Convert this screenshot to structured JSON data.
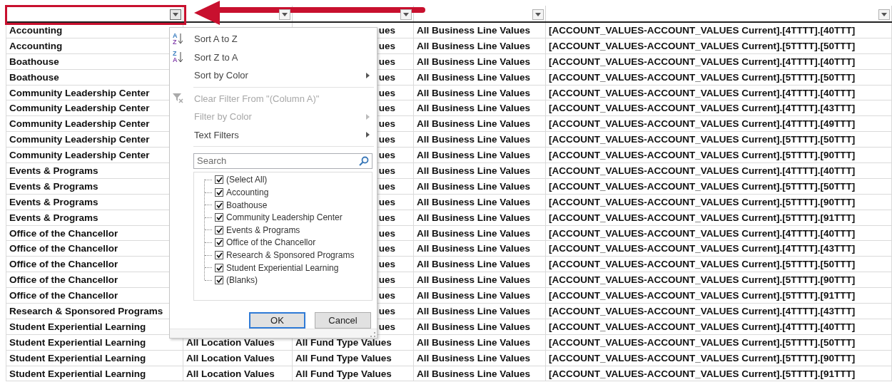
{
  "header": {
    "filter_buttons": [
      {
        "active": true
      },
      {
        "active": false
      },
      {
        "active": false
      },
      {
        "active": false
      },
      {
        "active": false
      }
    ]
  },
  "rows": [
    {
      "col_a": "Accounting",
      "col_c": "ues",
      "col_d": "All Business Line Values",
      "col_e": "[ACCOUNT_VALUES-ACCOUNT_VALUES Current].[4TTTT].[40TTT]"
    },
    {
      "col_a": "Accounting",
      "col_c": "ues",
      "col_d": "All Business Line Values",
      "col_e": "[ACCOUNT_VALUES-ACCOUNT_VALUES Current].[5TTTT].[50TTT]"
    },
    {
      "col_a": "Boathouse",
      "col_c": "ues",
      "col_d": "All Business Line Values",
      "col_e": "[ACCOUNT_VALUES-ACCOUNT_VALUES Current].[4TTTT].[40TTT]"
    },
    {
      "col_a": "Boathouse",
      "col_c": "ues",
      "col_d": "All Business Line Values",
      "col_e": "[ACCOUNT_VALUES-ACCOUNT_VALUES Current].[5TTTT].[50TTT]"
    },
    {
      "col_a": "Community Leadership Center",
      "col_c": "ues",
      "col_d": "All Business Line Values",
      "col_e": "[ACCOUNT_VALUES-ACCOUNT_VALUES Current].[4TTTT].[40TTT]"
    },
    {
      "col_a": "Community Leadership Center",
      "col_c": "ues",
      "col_d": "All Business Line Values",
      "col_e": "[ACCOUNT_VALUES-ACCOUNT_VALUES Current].[4TTTT].[43TTT]"
    },
    {
      "col_a": "Community Leadership Center",
      "col_c": "ues",
      "col_d": "All Business Line Values",
      "col_e": "[ACCOUNT_VALUES-ACCOUNT_VALUES Current].[4TTTT].[49TTT]"
    },
    {
      "col_a": "Community Leadership Center",
      "col_c": "ues",
      "col_d": "All Business Line Values",
      "col_e": "[ACCOUNT_VALUES-ACCOUNT_VALUES Current].[5TTTT].[50TTT]"
    },
    {
      "col_a": "Community Leadership Center",
      "col_c": "ues",
      "col_d": "All Business Line Values",
      "col_e": "[ACCOUNT_VALUES-ACCOUNT_VALUES Current].[5TTTT].[90TTT]"
    },
    {
      "col_a": "Events & Programs",
      "col_c": "ues",
      "col_d": "All Business Line Values",
      "col_e": "[ACCOUNT_VALUES-ACCOUNT_VALUES Current].[4TTTT].[40TTT]"
    },
    {
      "col_a": "Events & Programs",
      "col_c": "ues",
      "col_d": "All Business Line Values",
      "col_e": "[ACCOUNT_VALUES-ACCOUNT_VALUES Current].[5TTTT].[50TTT]"
    },
    {
      "col_a": "Events & Programs",
      "col_c": "ues",
      "col_d": "All Business Line Values",
      "col_e": "[ACCOUNT_VALUES-ACCOUNT_VALUES Current].[5TTTT].[90TTT]"
    },
    {
      "col_a": "Events & Programs",
      "col_c": "ues",
      "col_d": "All Business Line Values",
      "col_e": "[ACCOUNT_VALUES-ACCOUNT_VALUES Current].[5TTTT].[91TTT]"
    },
    {
      "col_a": "Office of the Chancellor",
      "col_c": "ues",
      "col_d": "All Business Line Values",
      "col_e": "[ACCOUNT_VALUES-ACCOUNT_VALUES Current].[4TTTT].[40TTT]"
    },
    {
      "col_a": "Office of the Chancellor",
      "col_c": "ues",
      "col_d": "All Business Line Values",
      "col_e": "[ACCOUNT_VALUES-ACCOUNT_VALUES Current].[4TTTT].[43TTT]"
    },
    {
      "col_a": "Office of the Chancellor",
      "col_c": "ues",
      "col_d": "All Business Line Values",
      "col_e": "[ACCOUNT_VALUES-ACCOUNT_VALUES Current].[5TTTT].[50TTT]"
    },
    {
      "col_a": "Office of the Chancellor",
      "col_c": "ues",
      "col_d": "All Business Line Values",
      "col_e": "[ACCOUNT_VALUES-ACCOUNT_VALUES Current].[5TTTT].[90TTT]"
    },
    {
      "col_a": "Office of the Chancellor",
      "col_c": "ues",
      "col_d": "All Business Line Values",
      "col_e": "[ACCOUNT_VALUES-ACCOUNT_VALUES Current].[5TTTT].[91TTT]"
    },
    {
      "col_a": "Research & Sponsored Programs",
      "col_c": "ues",
      "col_d": "All Business Line Values",
      "col_e": "[ACCOUNT_VALUES-ACCOUNT_VALUES Current].[4TTTT].[43TTT]"
    },
    {
      "col_a": "Student Experiential Learning",
      "col_c": "ues",
      "col_d": "All Business Line Values",
      "col_e": "[ACCOUNT_VALUES-ACCOUNT_VALUES Current].[4TTTT].[40TTT]"
    },
    {
      "col_a": "Student Experiential Learning",
      "col_b": "All Location Values",
      "col_c": "All Fund Type Values",
      "col_d": "All Business Line Values",
      "col_e": "[ACCOUNT_VALUES-ACCOUNT_VALUES Current].[5TTTT].[50TTT]"
    },
    {
      "col_a": "Student Experiential Learning",
      "col_b": "All Location Values",
      "col_c": "All Fund Type Values",
      "col_d": "All Business Line Values",
      "col_e": "[ACCOUNT_VALUES-ACCOUNT_VALUES Current].[5TTTT].[90TTT]"
    },
    {
      "col_a": "Student Experiential Learning",
      "col_b": "All Location Values",
      "col_c": "All Fund Type Values",
      "col_d": "All Business Line Values",
      "col_e": "[ACCOUNT_VALUES-ACCOUNT_VALUES Current].[5TTTT].[91TTT]"
    }
  ],
  "filter_menu": {
    "items": [
      {
        "kind": "sort",
        "label": "Sort A to Z",
        "icon_top": "A",
        "icon_bottom": "Z",
        "disabled": false,
        "submenu": false
      },
      {
        "kind": "sort",
        "label": "Sort Z to A",
        "icon_top": "Z",
        "icon_bottom": "A",
        "disabled": false,
        "submenu": false
      },
      {
        "kind": "plain",
        "label": "Sort by Color",
        "disabled": false,
        "submenu": true
      },
      {
        "kind": "divider"
      },
      {
        "kind": "clear",
        "label": "Clear Filter From \"(Column A)\"",
        "disabled": true,
        "submenu": false
      },
      {
        "kind": "plain",
        "label": "Filter by Color",
        "disabled": true,
        "submenu": true
      },
      {
        "kind": "plain",
        "label": "Text Filters",
        "disabled": false,
        "submenu": true
      },
      {
        "kind": "divider"
      }
    ],
    "search": {
      "placeholder": "Search"
    },
    "values": [
      {
        "label": "(Select All)",
        "checked": true
      },
      {
        "label": "Accounting",
        "checked": true
      },
      {
        "label": "Boathouse",
        "checked": true
      },
      {
        "label": "Community Leadership Center",
        "checked": true
      },
      {
        "label": "Events & Programs",
        "checked": true
      },
      {
        "label": "Office of the Chancellor",
        "checked": true
      },
      {
        "label": "Research & Sponsored Programs",
        "checked": true
      },
      {
        "label": "Student Experiential Learning",
        "checked": true
      },
      {
        "label": "(Blanks)",
        "checked": true
      }
    ],
    "buttons": [
      {
        "label": "OK",
        "selected": true
      },
      {
        "label": "Cancel",
        "selected": false
      }
    ]
  }
}
